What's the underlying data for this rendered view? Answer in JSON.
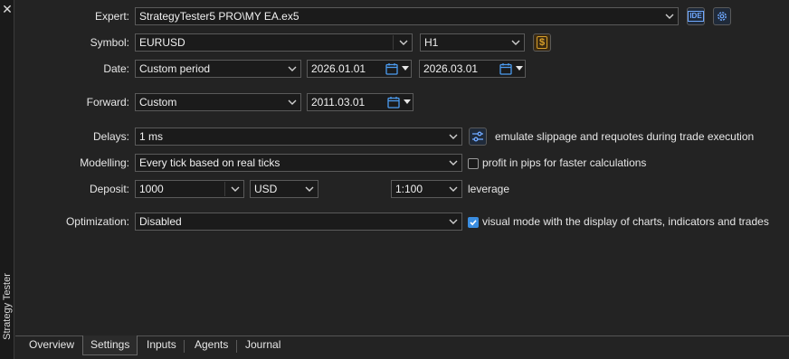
{
  "side_panel": {
    "close_label": "✕",
    "title": "Strategy Tester"
  },
  "form": {
    "expert": {
      "label": "Expert:",
      "value": "StrategyTester5 PRO\\MY EA.ex5",
      "ide_label": "IDE"
    },
    "symbol": {
      "label": "Symbol:",
      "value": "EURUSD",
      "timeframe": "H1",
      "currency_icon": "$"
    },
    "date": {
      "label": "Date:",
      "mode": "Custom period",
      "from": "2026.01.01",
      "to": "2026.03.01"
    },
    "forward": {
      "label": "Forward:",
      "mode": "Custom",
      "date": "2011.03.01"
    },
    "delays": {
      "label": "Delays:",
      "value": "1 ms",
      "note": "emulate slippage and requotes during trade execution"
    },
    "modelling": {
      "label": "Modelling:",
      "value": "Every tick based on real ticks",
      "option_label": "profit in pips for faster calculations",
      "option_checked": false
    },
    "deposit": {
      "label": "Deposit:",
      "amount": "1000",
      "currency": "USD",
      "leverage": "1:100",
      "leverage_label": "leverage"
    },
    "optimization": {
      "label": "Optimization:",
      "value": "Disabled",
      "option_label": "visual mode with the display of charts, indicators and trades",
      "option_checked": true
    }
  },
  "tabs": [
    {
      "label": "Overview",
      "active": false
    },
    {
      "label": "Settings",
      "active": true
    },
    {
      "label": "Inputs",
      "active": false
    },
    {
      "label": "Agents",
      "active": false
    },
    {
      "label": "Journal",
      "active": false
    }
  ],
  "colors": {
    "accent": "#3a8de0",
    "background": "#232323",
    "field": "#1b1b1b",
    "gold": "#d9a02a"
  }
}
